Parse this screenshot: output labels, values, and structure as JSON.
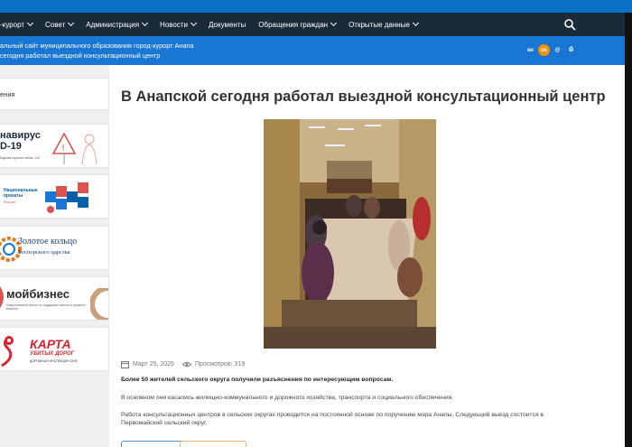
{
  "nav": {
    "items": [
      {
        "label": "-курорт",
        "chevron": true
      },
      {
        "label": "Совет",
        "chevron": true
      },
      {
        "label": "Администрация",
        "chevron": true
      },
      {
        "label": "Новости",
        "chevron": true
      },
      {
        "label": "Документы",
        "chevron": false
      },
      {
        "label": "Обращения граждан",
        "chevron": true
      },
      {
        "label": "Открытые данные",
        "chevron": true
      }
    ],
    "search_icon": "search-icon"
  },
  "banner": {
    "line1": "альный сайт муниципального образования город-курорт Анапа",
    "line2": "сегодня работал выездной консультационный центр",
    "social": [
      {
        "name": "vk-icon",
        "glyph": "вк",
        "color": "#1976d2"
      },
      {
        "name": "ok-icon",
        "glyph": "ок",
        "color": "#f39200"
      },
      {
        "name": "mail-icon",
        "glyph": "@",
        "color": "#1976d2"
      },
      {
        "name": "print-icon",
        "glyph": "⎙",
        "color": "#1976d2"
      }
    ]
  },
  "sidebar": {
    "top_label": "ения",
    "cards": [
      {
        "name": "covid-banner",
        "line1": "навирус",
        "line2": "D-19",
        "small": "Единая горячая линия: 112"
      },
      {
        "name": "national-projects-banner",
        "line1": "Национальные",
        "line2": "проекты",
        "small": "России"
      },
      {
        "name": "golden-ring-banner",
        "line1": "Золотое кольцо",
        "line2": "Боспорского царства"
      },
      {
        "name": "moy-biznes-banner",
        "line1": "мойбизнес",
        "line2": "Национальный проект по поддержке малого и среднего бизнеса"
      },
      {
        "name": "killed-roads-banner",
        "line1": "КАРТА",
        "line2": "УБИТЫХ ДОРОГ",
        "small": "ДОРОЖНАЯ ИНСПЕКЦИЯ ОНФ"
      }
    ]
  },
  "article": {
    "title": "В Анапской сегодня работал выездной консультационный центр",
    "date": "Март 25, 2025",
    "views": "Просмотров: 319",
    "p1": "Более 50 жителей сельского округа получили разъяснения по интересующим вопросам.",
    "p2": "В основном они касались жилищно-коммунального и дорожного хозяйства, транспорта и социального обеспечения.",
    "p3a": "Работа консультационных центров в сельских округах проводится на постоянной основе по поручению мэра Анапы. Следующий выезд состоится в",
    "p3b": "Первомайский сельский округ."
  },
  "colors": {
    "nav_bg": "#1b2a39",
    "banner_bg": "#1976d2",
    "accent_orange": "#f39200"
  }
}
